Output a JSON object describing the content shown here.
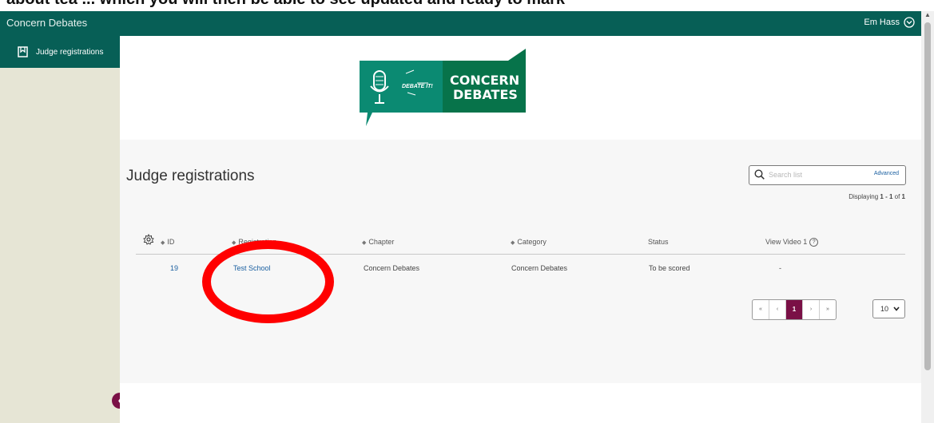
{
  "overlay": {
    "text": "about tea      ... which you will then be able to see updated and ready to mark"
  },
  "topbar": {
    "brand": "Concern Debates",
    "user_name": "Em Hass"
  },
  "sidebar": {
    "items": [
      {
        "label": "Judge registrations",
        "icon": "bookmark-icon"
      }
    ]
  },
  "logo": {
    "tagline": "DEBATE IT!",
    "line1": "CONCERN",
    "line2": "DEBATES"
  },
  "page": {
    "title": "Judge registrations",
    "search_placeholder": "Search list",
    "advanced_label": "Advanced",
    "displaying_prefix": "Displaying",
    "displaying_range": "1 - 1",
    "displaying_of": "of",
    "displaying_total": "1"
  },
  "table": {
    "columns": [
      "ID",
      "Registration",
      "Chapter",
      "Category",
      "Status",
      "View Video 1"
    ],
    "rows": [
      {
        "id": "19",
        "registration": "Test School",
        "chapter": "Concern Debates",
        "category": "Concern Debates",
        "status": "To be scored",
        "video": "-"
      }
    ]
  },
  "pagination": {
    "first": "«",
    "prev": "‹",
    "current": "1",
    "next": "›",
    "last": "»",
    "per_page": "10"
  },
  "colors": {
    "brand": "#075f56",
    "accent": "#7a1046",
    "annotation": "#ff0000"
  }
}
